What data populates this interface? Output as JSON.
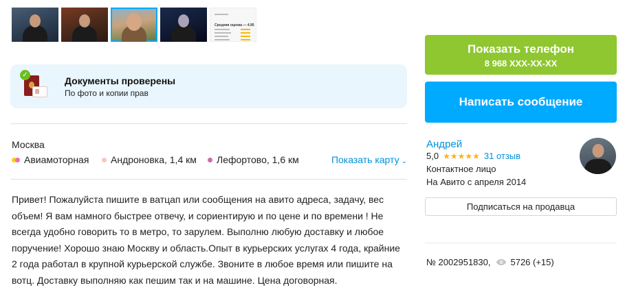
{
  "gallery": {
    "thumbnails": [
      {
        "label": "photo-1"
      },
      {
        "label": "photo-2"
      },
      {
        "label": "photo-3",
        "selected": true
      },
      {
        "label": "photo-4"
      },
      {
        "label": "rating-card",
        "title": "Средняя оценка — 4.95"
      }
    ]
  },
  "docs": {
    "title": "Документы проверены",
    "subtitle": "По фото и копии прав"
  },
  "address": {
    "city": "Москва",
    "metro": [
      {
        "name": "Авиамоторная",
        "colors": [
          "#ffcd1c",
          "#f06eab"
        ]
      },
      {
        "name": "Андроновка, 1,4 км",
        "colors": [
          "#f9c6c0"
        ]
      },
      {
        "name": "Лефортово, 1,6 км",
        "colors": [
          "#cc6caa"
        ]
      }
    ],
    "map_link": "Показать карту"
  },
  "description": "Привет! Пожалуйста пишите в ватцап или сообщения на авито адреса, задачу, вес объем! Я вам намного быстрее отвечу, и сориентирую и по цене и по времени ! Не всегда удобно говорить то в метро, то зарулем. Выполню любую доставку и любое поручение! Хорошо знаю Москву и область.Опыт в курьерских услугах 4 года, крайние 2 года работал в крупной курьерской службе. Звоните в любое время или пишите на вотц. Доставку выполняю как пешим так и на машине. Цена договорная.",
  "actions": {
    "phone_button": "Показать телефон",
    "phone_number": "8 968 XXX-XX-XX",
    "message_button": "Написать сообщение"
  },
  "seller": {
    "name": "Андрей",
    "rating": "5,0",
    "stars": "★★★★★",
    "reviews": "31 отзыв",
    "role": "Контактное лицо",
    "since": "На Авито с апреля 2014",
    "subscribe_button": "Подписаться на продавца"
  },
  "stats": {
    "ad_number": "№ 2002951830,",
    "views": "5726 (+15)"
  },
  "colors": {
    "accent_blue": "#00aaff",
    "phone_green": "#8fc730",
    "link_blue": "#0091d9",
    "docs_bg": "#e9f6fe",
    "star": "#ffb021"
  }
}
